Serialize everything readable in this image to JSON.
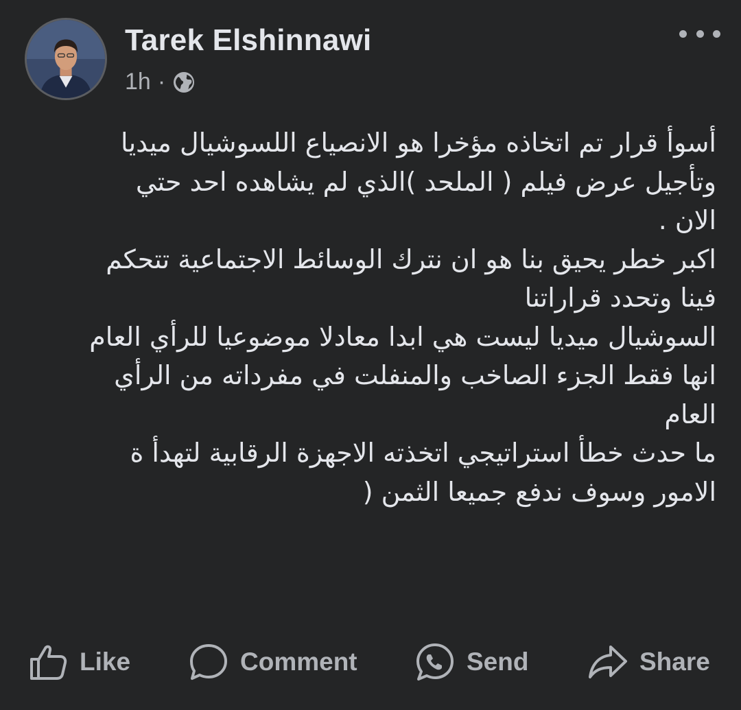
{
  "post": {
    "author": "Tarek Elshinnawi",
    "time": "1h",
    "separator": "·",
    "audience_icon": "globe-icon",
    "more_icon": "more-options-icon",
    "body_lines": [
      "أسوأ  قرار تم اتخاذه مؤخرا هو الانصياع اللسوشيال ميديا",
      "وتأجيل عرض فيلم ( الملحد )الذي لم يشاهده احد حتي",
      "الان  .",
      "اكبر خطر يحيق بنا هو ان نترك الوسائط الاجتماعية تتحكم",
      "فينا وتحدد قراراتنا",
      "السوشيال ميديا ليست هي ابدا معادلا موضوعيا للرأي العام",
      "انها  فقط الجزء الصاخب والمنفلت في مفرداته من الرأي",
      "العام",
      "ما حدث خطأ استراتيجي اتخذته الاجهزة الرقابية لتهدأ ة",
      "الامور وسوف ندفع جميعا الثمن ("
    ]
  },
  "actions": {
    "like": {
      "label": "Like",
      "icon": "thumbs-up-icon"
    },
    "comment": {
      "label": "Comment",
      "icon": "comment-bubble-icon"
    },
    "send": {
      "label": "Send",
      "icon": "messenger-icon"
    },
    "share": {
      "label": "Share",
      "icon": "share-arrow-icon"
    }
  },
  "colors": {
    "background": "#242526",
    "primary_text": "#e4e6eb",
    "secondary_text": "#b0b3b8"
  }
}
